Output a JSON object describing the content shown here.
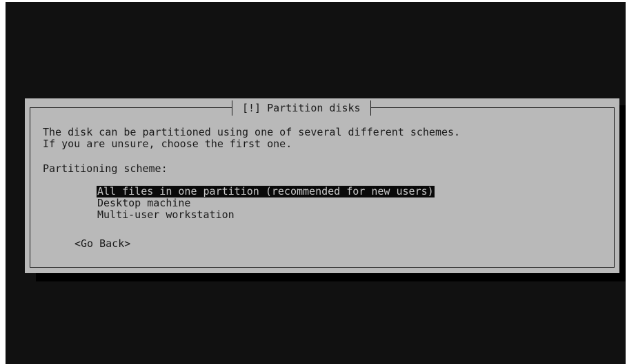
{
  "dialog": {
    "title": "[!] Partition disks",
    "description_line1": "The disk can be partitioned using one of several different schemes.",
    "description_line2": "If you are unsure, choose the first one.",
    "scheme_label": "Partitioning scheme:",
    "options": [
      {
        "label": "All files in one partition (recommended for new users)",
        "selected": true
      },
      {
        "label": "Desktop machine",
        "selected": false
      },
      {
        "label": "Multi-user workstation",
        "selected": false
      }
    ],
    "back_button": "<Go Back>"
  },
  "colors": {
    "screen_background": "#111111",
    "dialog_background": "#b9b9b9",
    "text": "#1a1a1a",
    "selection_background": "#0a0a0a",
    "selection_text": "#c8c8c8"
  }
}
